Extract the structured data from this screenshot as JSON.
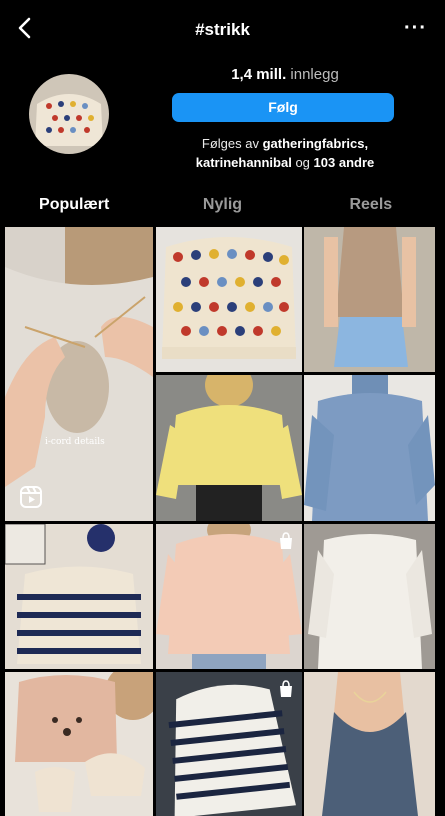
{
  "header": {
    "title": "#strikk",
    "back_icon": "chevron-left-icon",
    "more_icon": "more-horizontal-icon"
  },
  "profile": {
    "post_count": "1,4 mill.",
    "post_unit": "innlegg",
    "follow_label": "Følg",
    "followed_prefix": "Følges av",
    "followed_user_1": "gatheringfabrics,",
    "followed_user_2": "katrinehannibal",
    "followed_and": "og",
    "followed_others": "103 andre"
  },
  "tabs": [
    {
      "label": "Populært",
      "active": true
    },
    {
      "label": "Nylig",
      "active": false
    },
    {
      "label": "Reels",
      "active": false
    }
  ],
  "grid": {
    "reel_caption": "i-cord details",
    "reel_icon": "reels-icon",
    "shop_icon": "shopping-bag-icon"
  },
  "colors": {
    "accent": "#1a94f5",
    "background": "#000000"
  }
}
